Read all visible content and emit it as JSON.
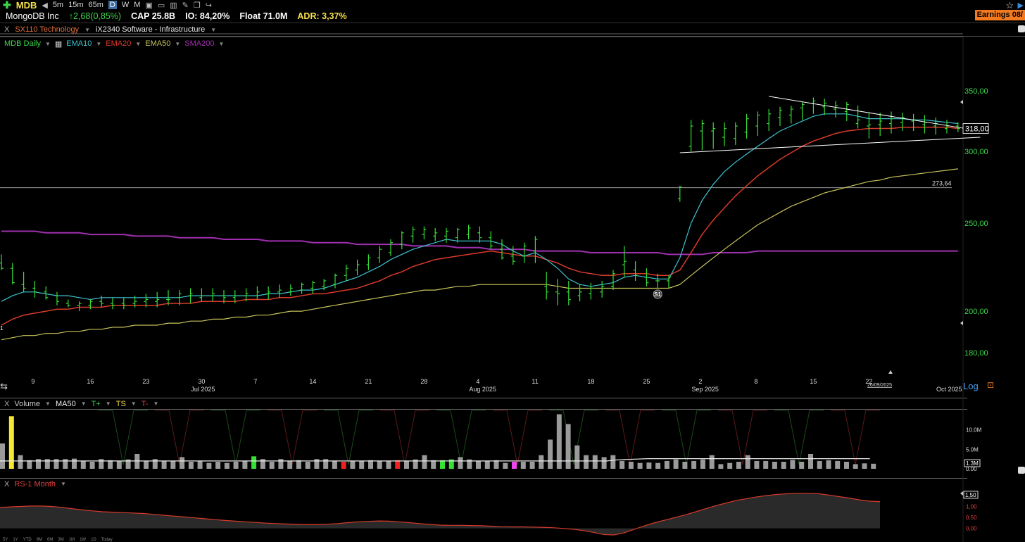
{
  "toolbar": {
    "symbol": "MDB",
    "timeframes": [
      {
        "label": "5m",
        "active": false
      },
      {
        "label": "15m",
        "active": false
      },
      {
        "label": "65m",
        "active": false
      },
      {
        "label": "D",
        "active": true
      },
      {
        "label": "W",
        "active": false
      },
      {
        "label": "M",
        "active": false
      }
    ]
  },
  "info": {
    "name": "MongoDB Inc",
    "change": "↑2,68(0,85%)",
    "cap": "CAP 25.8B",
    "io": "IO: 84,20%",
    "float": "Float 71.0M",
    "adr": "ADR: 3,37%",
    "earnings": "Earnings 08/"
  },
  "industry": {
    "close": "X",
    "sector": "SX110 Technology",
    "group": "iX2340 Software - Infrastructure"
  },
  "legend": {
    "chart_name": "MDB Daily",
    "items": [
      {
        "label": "EMA10",
        "color": "#3ec3d0"
      },
      {
        "label": "EMA20",
        "color": "#d93a2a"
      },
      {
        "label": "EMA50",
        "color": "#c8c45a"
      },
      {
        "label": "SMA200",
        "color": "#a02fb0"
      }
    ]
  },
  "volume_panel": {
    "close": "X",
    "title": "Volume",
    "ma": "MA50",
    "t_plus": "T+",
    "ts": "TS",
    "t_minus": "T-"
  },
  "rs_panel": {
    "close": "X",
    "title": "RS-1 Month"
  },
  "controls": {
    "log": "Log"
  },
  "periods": [
    "5Y",
    "1Y",
    "YTD",
    "9M",
    "6M",
    "3M",
    "1M",
    "1W",
    "1D",
    "Today"
  ],
  "chart_data": [
    {
      "type": "bar",
      "subtype": "ohlc",
      "title": "MDB Daily",
      "yscale": "log",
      "ylim": [
        174,
        362
      ],
      "ytick_labels": [
        "350,00",
        "300,00",
        "250,00",
        "200,00",
        "180,00"
      ],
      "yticks": [
        350,
        300,
        250,
        200,
        180
      ],
      "xtick_labels": [
        {
          "label": "9",
          "bar": 3
        },
        {
          "label": "16",
          "bar": 8
        },
        {
          "label": "23",
          "bar": 13
        },
        {
          "label": "30",
          "bar": 18
        },
        {
          "label": "7",
          "bar": 23
        },
        {
          "label": "14",
          "bar": 28
        },
        {
          "label": "21",
          "bar": 33
        },
        {
          "label": "28",
          "bar": 38
        },
        {
          "label": "4",
          "bar": 43
        },
        {
          "label": "11",
          "bar": 48
        },
        {
          "label": "18",
          "bar": 53
        },
        {
          "label": "25",
          "bar": 58
        },
        {
          "label": "2",
          "bar": 63
        },
        {
          "label": "8",
          "bar": 68
        },
        {
          "label": "15",
          "bar": 73
        },
        {
          "label": "22",
          "bar": 78
        }
      ],
      "month_labels": [
        {
          "label": "Jul 2025",
          "bar": 18
        },
        {
          "label": "Aug 2025",
          "bar": 43
        },
        {
          "label": "Sep 2025",
          "bar": 63
        },
        {
          "label": "Oct 2025",
          "bar": 85
        }
      ],
      "last_date_label": "26/09/2025",
      "price_label": "318,00",
      "horizontal_line": {
        "value": 273.64,
        "label": "273,64"
      },
      "event_marker": {
        "label": "S1",
        "bar": 59
      },
      "first_marker": "1",
      "high": [
        231,
        226,
        221,
        216,
        213,
        210,
        206,
        205,
        206,
        208,
        207,
        207,
        208,
        209,
        210,
        211,
        211,
        212,
        212,
        212,
        211,
        211,
        212,
        213,
        213,
        214,
        214,
        215,
        216,
        217,
        220,
        225,
        228,
        231,
        236,
        240,
        245,
        248,
        248,
        247,
        247,
        247,
        249,
        248,
        245,
        240,
        236,
        238,
        242,
        221,
        217,
        216,
        214,
        215,
        216,
        222,
        236,
        227,
        223,
        220,
        219,
        275,
        325,
        325,
        323,
        323,
        323,
        330,
        332,
        334,
        336,
        337,
        340,
        344,
        343,
        341,
        340,
        337,
        331,
        331,
        332,
        331,
        330,
        329,
        327,
        325,
        323
      ],
      "low": [
        222,
        214,
        210,
        207,
        206,
        203,
        202,
        200,
        201,
        202,
        201,
        201,
        202,
        202,
        202,
        203,
        203,
        204,
        205,
        205,
        204,
        204,
        205,
        206,
        206,
        207,
        208,
        209,
        209,
        211,
        212,
        216,
        219,
        222,
        226,
        230,
        234,
        238,
        240,
        239,
        238,
        238,
        240,
        238,
        234,
        228,
        225,
        226,
        226,
        206,
        203,
        203,
        205,
        206,
        207,
        211,
        218,
        216,
        213,
        212,
        212,
        264,
        300,
        301,
        302,
        304,
        305,
        310,
        312,
        316,
        320,
        322,
        325,
        330,
        329,
        327,
        324,
        318,
        310,
        312,
        314,
        316,
        316,
        314,
        313,
        314,
        315
      ],
      "open": [
        226,
        223,
        214,
        212,
        210,
        208,
        204,
        203,
        203,
        205,
        204,
        204,
        204,
        205,
        205,
        206,
        207,
        208,
        207,
        208,
        208,
        207,
        208,
        208,
        209,
        210,
        210,
        211,
        212,
        213,
        214,
        219,
        222,
        225,
        229,
        232,
        237,
        242,
        243,
        242,
        242,
        241,
        243,
        244,
        241,
        234,
        230,
        230,
        233,
        213,
        210,
        210,
        208,
        209,
        210,
        213,
        225,
        222,
        218,
        216,
        216,
        266,
        304,
        316,
        316,
        311,
        310,
        315,
        320,
        322,
        327,
        329,
        335,
        339,
        336,
        334,
        332,
        322,
        320,
        321,
        322,
        323,
        324,
        321,
        320,
        318,
        320
      ],
      "close": [
        223,
        215,
        212,
        210,
        207,
        205,
        203,
        204,
        205,
        204,
        203,
        203,
        205,
        206,
        206,
        206,
        209,
        209,
        208,
        209,
        207,
        208,
        209,
        210,
        210,
        211,
        212,
        214,
        215,
        216,
        219,
        223,
        225,
        229,
        234,
        238,
        244,
        246,
        246,
        244,
        245,
        246,
        247,
        241,
        236,
        229,
        227,
        236,
        240,
        210,
        209,
        206,
        210,
        212,
        213,
        220,
        227,
        219,
        215,
        216,
        218,
        274,
        320,
        322,
        318,
        318,
        320,
        326,
        329,
        330,
        333,
        334,
        338,
        341,
        339,
        337,
        338,
        325,
        321,
        324,
        326,
        327,
        325,
        323,
        322,
        320,
        318
      ],
      "ema10": [
        205,
        208,
        210,
        210,
        209,
        208,
        208,
        207,
        206,
        207,
        207,
        207,
        207,
        207,
        207,
        207,
        207,
        208,
        208,
        208,
        208,
        208,
        208,
        208,
        209,
        209,
        210,
        211,
        211,
        212,
        214,
        216,
        218,
        221,
        224,
        228,
        231,
        234,
        236,
        238,
        240,
        239,
        239,
        239,
        239,
        237,
        233,
        230,
        232,
        228,
        223,
        217,
        214,
        213,
        214,
        215,
        218,
        219,
        218,
        217,
        217,
        229,
        250,
        265,
        276,
        285,
        292,
        298,
        304,
        310,
        316,
        320,
        324,
        328,
        330,
        330,
        330,
        328,
        326,
        326,
        326,
        326,
        325,
        325,
        324,
        323,
        322
      ],
      "ema20": [
        193,
        196,
        198,
        199,
        200,
        201,
        201,
        202,
        202,
        202,
        203,
        203,
        203,
        203,
        203,
        204,
        204,
        204,
        205,
        205,
        205,
        205,
        206,
        206,
        206,
        207,
        207,
        208,
        209,
        209,
        210,
        211,
        212,
        214,
        216,
        219,
        221,
        224,
        226,
        228,
        229,
        230,
        231,
        232,
        233,
        232,
        231,
        230,
        230,
        228,
        226,
        223,
        221,
        220,
        219,
        219,
        220,
        220,
        220,
        219,
        219,
        222,
        232,
        243,
        252,
        260,
        268,
        275,
        282,
        288,
        294,
        299,
        304,
        308,
        311,
        314,
        316,
        317,
        318,
        318,
        318,
        319,
        319,
        319,
        319,
        319,
        318
      ],
      "ema50": [
        186,
        187,
        188,
        188,
        189,
        189,
        190,
        190,
        191,
        191,
        192,
        192,
        193,
        193,
        193,
        194,
        194,
        195,
        195,
        196,
        196,
        197,
        197,
        198,
        198,
        199,
        200,
        200,
        201,
        202,
        203,
        204,
        205,
        206,
        207,
        208,
        209,
        210,
        211,
        211,
        212,
        213,
        213,
        214,
        214,
        214,
        214,
        214,
        214,
        214,
        213,
        212,
        212,
        212,
        212,
        212,
        212,
        212,
        212,
        212,
        212,
        214,
        219,
        224,
        229,
        234,
        239,
        244,
        249,
        253,
        257,
        261,
        264,
        267,
        270,
        272,
        274,
        276,
        278,
        279,
        281,
        282,
        283,
        284,
        285,
        286,
        287
      ],
      "sma200": [
        245,
        245,
        245,
        245,
        244,
        244,
        244,
        244,
        243,
        243,
        243,
        243,
        242,
        242,
        242,
        242,
        241,
        241,
        241,
        241,
        240,
        240,
        240,
        240,
        239,
        239,
        239,
        239,
        238,
        238,
        238,
        238,
        237,
        237,
        237,
        237,
        237,
        236,
        236,
        236,
        236,
        235,
        235,
        235,
        234,
        234,
        234,
        234,
        233,
        233,
        233,
        233,
        233,
        232,
        232,
        232,
        232,
        232,
        232,
        232,
        231,
        231,
        231,
        231,
        232,
        232,
        232,
        232,
        233,
        233,
        233,
        233,
        233,
        233,
        233,
        233,
        233,
        233,
        233,
        233,
        233,
        233,
        233,
        233,
        233,
        233,
        233
      ],
      "triangle": {
        "upper": [
          {
            "bar": 69,
            "value": 345
          },
          {
            "bar": 88,
            "value": 316
          }
        ],
        "lower": [
          {
            "bar": 61,
            "value": 299
          },
          {
            "bar": 88,
            "value": 311
          }
        ]
      }
    },
    {
      "type": "bar",
      "title": "Volume",
      "unit": "M",
      "ytick_labels": [
        "10.0M",
        "5.0M",
        "0.00"
      ],
      "yticks": [
        10,
        5,
        0
      ],
      "ylim": [
        0,
        15
      ],
      "last_label": "1.3M",
      "ma50": [
        2.0,
        2.0,
        2.0,
        2.0,
        2.0,
        2.0,
        2.0,
        2.0,
        2.0,
        2.0,
        2.0,
        2.0,
        2.0,
        2.0,
        2.0,
        2.0,
        2.0,
        2.0,
        2.0,
        2.0,
        2.0,
        2.0,
        2.0,
        2.0,
        2.0,
        2.0,
        2.0,
        2.0,
        2.0,
        2.0,
        2.0,
        2.0,
        2.0,
        2.0,
        2.0,
        2.0,
        2.0,
        2.0,
        2.0,
        2.0,
        2.0,
        2.0,
        2.0,
        2.0,
        2.0,
        2.0,
        2.0,
        2.0,
        2.0,
        2.0,
        2.0,
        2.0,
        2.0,
        2.0,
        2.0,
        2.0,
        2.0,
        2.0,
        2.0,
        2.0,
        2.0,
        2.3,
        2.4,
        2.5,
        2.6,
        2.6,
        2.6,
        2.6,
        2.6,
        2.6,
        2.6,
        2.6,
        2.6,
        2.6,
        2.6,
        2.6,
        2.6,
        2.6,
        2.6,
        2.6,
        2.6,
        2.6,
        2.6,
        2.6,
        2.6,
        2.6,
        2.6
      ],
      "values": [
        6.5,
        13.5,
        3.5,
        2.2,
        2.5,
        2.5,
        2.5,
        2.5,
        2.6,
        2.0,
        1.8,
        2.5,
        2.2,
        2.0,
        2.4,
        3.8,
        2.0,
        2.5,
        2.0,
        2.0,
        3.0,
        1.8,
        2.0,
        1.5,
        1.8,
        1.5,
        1.8,
        2.0,
        3.2,
        2.5,
        1.8,
        2.5,
        2.0,
        2.2,
        1.8,
        2.5,
        2.5,
        2.0,
        1.8,
        2.0,
        2.0,
        2.2,
        2.0,
        2.0,
        2.2,
        2.0,
        2.4,
        3.5,
        2.2,
        2.2,
        2.4,
        3.0,
        2.4,
        2.0,
        2.0,
        2.2,
        1.5,
        1.8,
        1.8,
        1.8,
        3.5,
        7.5,
        14.0,
        11.5,
        6.0,
        3.5,
        3.5,
        3.0,
        3.5,
        2.0,
        1.8,
        1.5,
        1.6,
        1.5,
        2.0,
        2.4,
        1.8,
        2.0,
        2.4,
        3.5,
        1.2,
        1.5,
        1.8,
        3.5,
        2.0,
        2.0,
        1.8,
        1.8,
        2.3,
        1.8,
        3.8,
        2.0,
        2.2,
        2.0,
        1.8,
        1.2,
        1.4,
        1.3
      ],
      "bar_colors": [
        "#9a9a9a",
        "#f5e830",
        "#9a9a9a",
        "#9a9a9a",
        "#9a9a9a",
        "#9a9a9a",
        "#9a9a9a",
        "#9a9a9a",
        "#9a9a9a",
        "#9a9a9a",
        "#9a9a9a",
        "#9a9a9a",
        "#9a9a9a",
        "#9a9a9a",
        "#9a9a9a",
        "#9a9a9a",
        "#9a9a9a",
        "#9a9a9a",
        "#9a9a9a",
        "#9a9a9a",
        "#9a9a9a",
        "#9a9a9a",
        "#9a9a9a",
        "#9a9a9a",
        "#9a9a9a",
        "#9a9a9a",
        "#9a9a9a",
        "#9a9a9a",
        "#9a9a9a",
        "#9a9a9a",
        "#9a9a9a",
        "#9a9a9a",
        "#9a9a9a",
        "#9a9a9a",
        "#9a9a9a",
        "#9a9a9a",
        "#9a9a9a",
        "#9a9a9a",
        "#9a9a9a",
        "#9a9a9a",
        "#9a9a9a",
        "#9a9a9a",
        "#9a9a9a",
        "#9a9a9a",
        "#9a9a9a",
        "#9a9a9a",
        "#9a9a9a",
        "#9a9a9a",
        "#9a9a9a",
        "#9a9a9a",
        "#9a9a9a",
        "#9a9a9a",
        "#9a9a9a",
        "#9a9a9a",
        "#9a9a9a",
        "#9a9a9a",
        "#9a9a9a",
        "#9a9a9a",
        "#9a9a9a",
        "#9a9a9a",
        "#9a9a9a",
        "#9a9a9a",
        "#9a9a9a",
        "#9a9a9a",
        "#9a9a9a",
        "#9a9a9a",
        "#9a9a9a",
        "#9a9a9a",
        "#9a9a9a",
        "#9a9a9a",
        "#9a9a9a",
        "#9a9a9a",
        "#9a9a9a",
        "#9a9a9a",
        "#9a9a9a",
        "#9a9a9a",
        "#9a9a9a",
        "#9a9a9a",
        "#9a9a9a",
        "#9a9a9a",
        "#9a9a9a",
        "#9a9a9a",
        "#9a9a9a",
        "#9a9a9a",
        "#9a9a9a",
        "#9a9a9a",
        "#9a9a9a",
        "#9a9a9a",
        "#9a9a9a",
        "#9a9a9a",
        "#9a9a9a",
        "#9a9a9a",
        "#9a9a9a",
        "#9a9a9a",
        "#9a9a9a",
        "#9a9a9a",
        "#9a9a9a",
        "#9a9a9a"
      ],
      "highlights": {
        "28": "#33e033",
        "38": "#ee2020",
        "44": "#ee2020",
        "49": "#33e033",
        "50": "#33e033",
        "57": "#ee44ee"
      }
    },
    {
      "type": "area",
      "title": "RS-1 Month",
      "ytick_labels": [
        "1,50",
        "1,00",
        "0,50",
        "0,00"
      ],
      "yticks": [
        1.5,
        1.0,
        0.5,
        0.0
      ],
      "ylim": [
        -0.3,
        1.85
      ],
      "last_label": "1,50",
      "line_color": "#d93a2a",
      "values": [
        0.95,
        0.98,
        1.0,
        1.02,
        1.02,
        1.0,
        0.96,
        0.9,
        0.85,
        0.8,
        0.76,
        0.74,
        0.72,
        0.7,
        0.68,
        0.64,
        0.6,
        0.56,
        0.52,
        0.48,
        0.44,
        0.4,
        0.36,
        0.33,
        0.3,
        0.27,
        0.24,
        0.22,
        0.2,
        0.18,
        0.17,
        0.17,
        0.19,
        0.22,
        0.26,
        0.3,
        0.32,
        0.34,
        0.33,
        0.3,
        0.26,
        0.22,
        0.18,
        0.15,
        0.14,
        0.14,
        0.13,
        0.12,
        0.1,
        0.08,
        0.07,
        0.07,
        0.06,
        0.05,
        0.03,
        0.0,
        -0.04,
        -0.1,
        -0.18,
        -0.28,
        -0.3,
        -0.2,
        -0.04,
        0.12,
        0.26,
        0.38,
        0.5,
        0.62,
        0.76,
        0.9,
        1.04,
        1.16,
        1.28,
        1.36,
        1.44,
        1.5,
        1.55,
        1.58,
        1.6,
        1.6,
        1.58,
        1.52,
        1.45,
        1.38,
        1.3,
        1.24,
        1.22
      ]
    }
  ]
}
